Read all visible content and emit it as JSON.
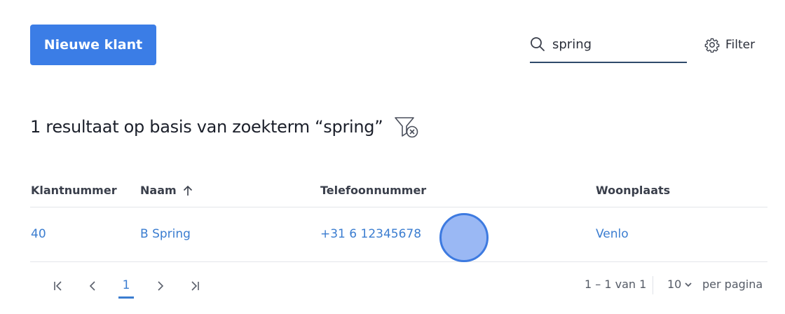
{
  "toolbar": {
    "new_customer_label": "Nieuwe klant",
    "search_value": "spring",
    "filter_label": "Filter"
  },
  "results": {
    "heading": "1 resultaat op basis van zoekterm “spring”"
  },
  "table": {
    "columns": [
      "Klantnummer",
      "Naam",
      "Telefoonnummer",
      "Woonplaats"
    ],
    "sorted_column": "Naam",
    "sort_direction": "ascending",
    "rows": [
      {
        "klantnummer": "40",
        "naam": "B Spring",
        "telefoon": "+31 6 12345678",
        "woonplaats": "Venlo"
      }
    ]
  },
  "pagination": {
    "current_page": "1",
    "range": "1 – 1 van 1",
    "per_page_value": "10",
    "per_page_label": "per pagina"
  },
  "colors": {
    "primary": "#3b7de6",
    "link": "#3b7dd0",
    "search_underline": "#2f4a6b"
  },
  "icons": [
    "search-icon",
    "gear-icon",
    "filter-clear-icon",
    "arrow-up-icon",
    "first-page-icon",
    "prev-page-icon",
    "next-page-icon",
    "last-page-icon",
    "chevron-down-icon"
  ]
}
